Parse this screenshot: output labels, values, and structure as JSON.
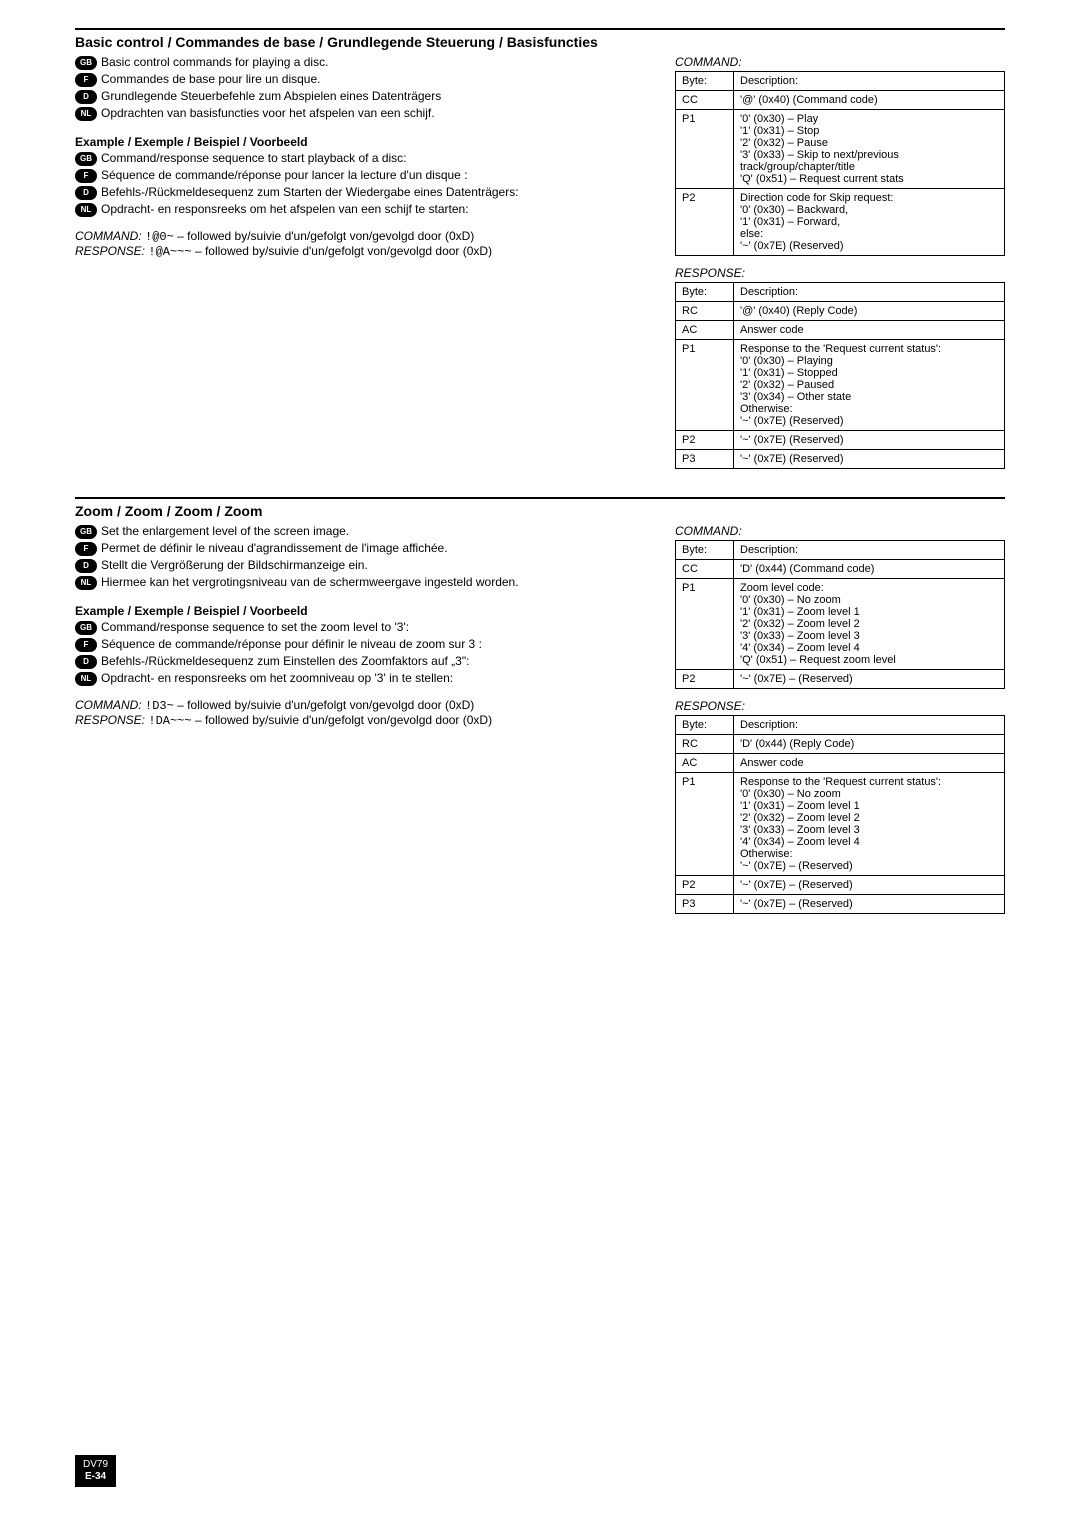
{
  "section1": {
    "title": "Basic control / Commandes de base / Grundlegende Steuerung / Basisfuncties",
    "langs": {
      "gb": "Basic control commands for playing a disc.",
      "f": "Commandes de base pour lire un disque.",
      "d": "Grundlegende Steuerbefehle zum Abspielen eines Datenträgers",
      "nl": "Opdrachten van basisfuncties voor het afspelen van een schijf."
    },
    "example_head": "Example / Exemple / Beispiel / Voorbeeld",
    "example": {
      "gb": "Command/response sequence to start playback of a disc:",
      "f": "Séquence de commande/réponse pour lancer la lecture d'un disque :",
      "d": "Befehls-/Rückmeldesequenz zum Starten der Wiedergabe eines Datenträgers:",
      "nl": "Opdracht- en responsreeks om het afspelen van een schijf te starten:"
    },
    "io": {
      "cmd_label": "COMMAND:",
      "cmd_code": "!@0~",
      "cmd_tail": " – followed by/suivie d'un/gefolgt von/gevolgd door (0xD)",
      "resp_label": "RESPONSE:",
      "resp_code": "!@A~~~",
      "resp_tail": " – followed by/suivie d'un/gefolgt von/gevolgd door (0xD)"
    },
    "cmd_table": {
      "title": "COMMAND:",
      "rows": {
        "h_byte": "Byte:",
        "h_desc": "Description:",
        "cc_b": "CC",
        "cc_d": "'@' (0x40) (Command code)",
        "p1_b": "P1",
        "p1_l0": "'0' (0x30) – Play",
        "p1_l1": "'1' (0x31) – Stop",
        "p1_l2": "'2' (0x32) – Pause",
        "p1_l3": "'3' (0x33) – Skip to next/previous track/group/chapter/title",
        "p1_l4": "'Q' (0x51) – Request current stats",
        "p2_b": "P2",
        "p2_l0": "Direction code for Skip request:",
        "p2_l1": "'0' (0x30) – Backward,",
        "p2_l2": "'1' (0x31) – Forward,",
        "p2_l3": "else:",
        "p2_l4": "'~' (0x7E) (Reserved)"
      }
    },
    "resp_table": {
      "title": "RESPONSE:",
      "rows": {
        "h_byte": "Byte:",
        "h_desc": "Description:",
        "rc_b": "RC",
        "rc_d": "'@' (0x40) (Reply Code)",
        "ac_b": "AC",
        "ac_d": "Answer code",
        "p1_b": "P1",
        "p1_l0": "Response to the 'Request current status':",
        "p1_l1": "'0' (0x30) – Playing",
        "p1_l2": "'1' (0x31) – Stopped",
        "p1_l3": "'2' (0x32) – Paused",
        "p1_l4": "'3' (0x34) – Other state",
        "p1_l5": "Otherwise:",
        "p1_l6": "'~' (0x7E) (Reserved)",
        "p2_b": "P2",
        "p2_d": "'~' (0x7E) (Reserved)",
        "p3_b": "P3",
        "p3_d": "'~' (0x7E) (Reserved)"
      }
    }
  },
  "section2": {
    "title": "Zoom / Zoom / Zoom / Zoom",
    "langs": {
      "gb": "Set the enlargement level of the screen image.",
      "f": "Permet de définir le niveau d'agrandissement de l'image affichée.",
      "d": "Stellt die Vergrößerung der Bildschirmanzeige ein.",
      "nl": "Hiermee kan het vergrotingsniveau van de schermweergave ingesteld worden."
    },
    "example_head": "Example / Exemple / Beispiel / Voorbeeld",
    "example": {
      "gb": "Command/response sequence to set the zoom level to '3':",
      "f": "Séquence de commande/réponse pour définir le niveau de zoom sur 3 :",
      "d": "Befehls-/Rückmeldesequenz zum Einstellen des Zoomfaktors auf „3\":",
      "nl": "Opdracht- en responsreeks om het zoomniveau op '3' in te stellen:"
    },
    "io": {
      "cmd_label": "COMMAND:",
      "cmd_code": "!D3~",
      "cmd_tail": " – followed by/suivie d'un/gefolgt von/gevolgd door (0xD)",
      "resp_label": "RESPONSE:",
      "resp_code": "!DA~~~",
      "resp_tail": " – followed by/suivie d'un/gefolgt von/gevolgd door (0xD)"
    },
    "cmd_table": {
      "title": "COMMAND:",
      "rows": {
        "h_byte": "Byte:",
        "h_desc": "Description:",
        "cc_b": "CC",
        "cc_d": "'D' (0x44) (Command code)",
        "p1_b": "P1",
        "p1_l0": "Zoom level code:",
        "p1_l1": "'0' (0x30) – No zoom",
        "p1_l2": "'1' (0x31) – Zoom level 1",
        "p1_l3": "'2' (0x32) – Zoom level 2",
        "p1_l4": "'3' (0x33) – Zoom level 3",
        "p1_l5": "'4' (0x34) – Zoom level 4",
        "p1_l6": "'Q' (0x51) – Request zoom level",
        "p2_b": "P2",
        "p2_d": "'~' (0x7E) – (Reserved)"
      }
    },
    "resp_table": {
      "title": "RESPONSE:",
      "rows": {
        "h_byte": "Byte:",
        "h_desc": "Description:",
        "rc_b": "RC",
        "rc_d": "'D' (0x44) (Reply Code)",
        "ac_b": "AC",
        "ac_d": "Answer code",
        "p1_b": "P1",
        "p1_l0": "Response to the 'Request current status':",
        "p1_l1": "'0' (0x30) – No zoom",
        "p1_l2": "'1' (0x31) – Zoom level 1",
        "p1_l3": "'2' (0x32) – Zoom level 2",
        "p1_l4": "'3' (0x33) – Zoom level 3",
        "p1_l5": "'4' (0x34) – Zoom level 4",
        "p1_l6": "Otherwise:",
        "p1_l7": "'~' (0x7E) – (Reserved)",
        "p2_b": "P2",
        "p2_d": "'~' (0x7E) – (Reserved)",
        "p3_b": "P3",
        "p3_d": "'~' (0x7E) – (Reserved)"
      }
    }
  },
  "page": {
    "model": "DV79",
    "num": "E-34"
  }
}
